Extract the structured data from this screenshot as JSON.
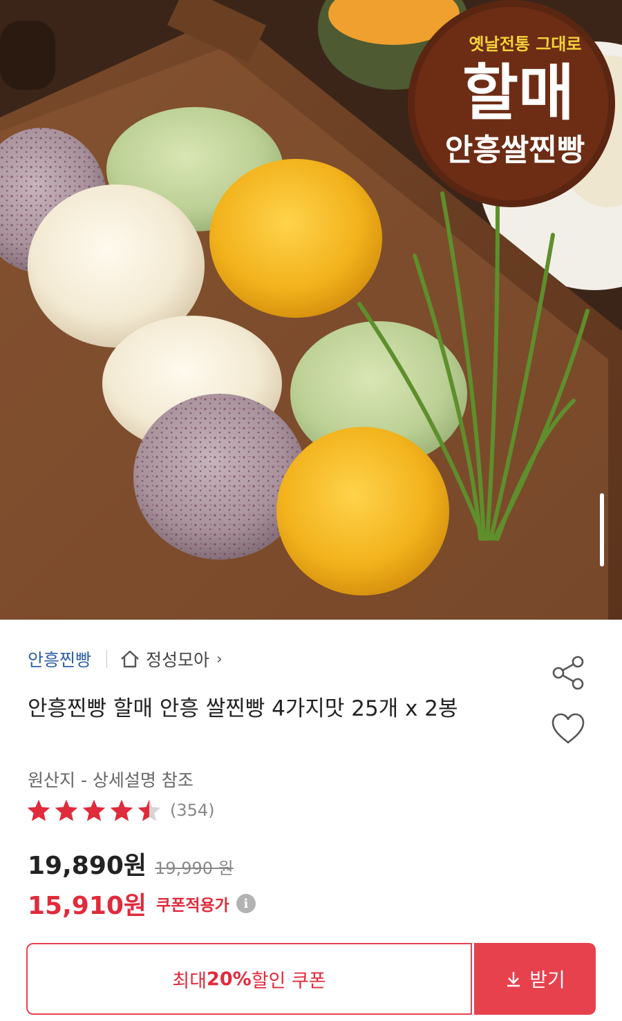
{
  "hero": {
    "logo_small_text": "옛날전통 그대로",
    "logo_main_text": "할매",
    "logo_sub_text": "안흥쌀찐빵"
  },
  "product": {
    "brand": "안흥찐빵",
    "store": "정성모아",
    "title": "안흥찐빵 할매 안흥 쌀찐빵 4가지맛 25개 x 2봉",
    "origin": "원산지 - 상세설명 참조",
    "rating": 4.5,
    "review_count": "(354)",
    "price": "19,890원",
    "original_price": "19,990 원",
    "coupon_price": "15,910원",
    "coupon_price_label": "쿠폰적용가",
    "coupon_text_prefix": "최대 ",
    "coupon_text_bold": "20%",
    "coupon_text_suffix": " 할인 쿠폰",
    "coupon_button": "받기"
  },
  "colors": {
    "brand_blue": "#2f5fa8",
    "accent_red": "#e02b3c",
    "button_red": "#e8414e",
    "star_red": "#e02b3c"
  },
  "icons": [
    "home-icon",
    "chevron-right-icon",
    "share-icon",
    "heart-icon",
    "star-icon",
    "info-icon",
    "download-icon"
  ]
}
